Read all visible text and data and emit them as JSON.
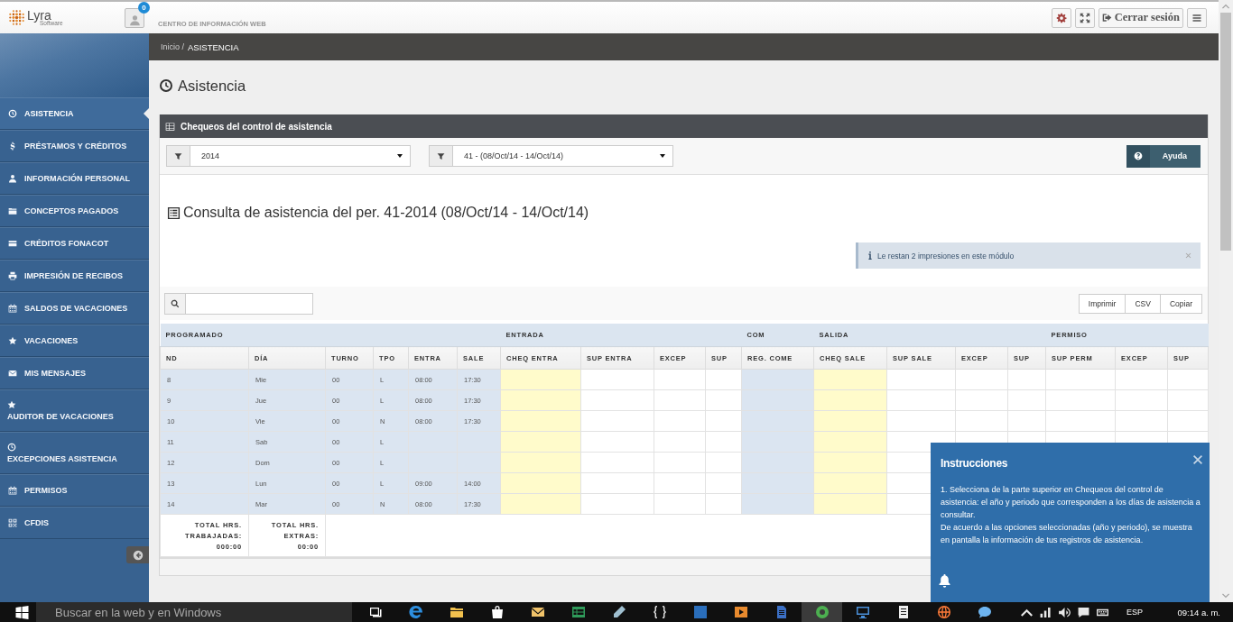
{
  "header": {
    "logo": {
      "name": "Lyra",
      "tagline": "Software"
    },
    "notifications": {
      "badge": "0"
    },
    "subtitle": "CENTRO DE INFORMACIÓN WEB",
    "logout": {
      "label": "Cerrar sesión"
    }
  },
  "sidebar": {
    "items": [
      {
        "label": "ASISTENCIA",
        "kind": "inline",
        "selected": true
      },
      {
        "label": "PRÉSTAMOS Y CRÉDITOS",
        "kind": "inline",
        "selected": false
      },
      {
        "label": "INFORMACIÓN PERSONAL",
        "kind": "inline",
        "selected": false
      },
      {
        "label": "CONCEPTOS PAGADOS",
        "kind": "inline",
        "selected": false
      },
      {
        "label": "CRÉDITOS FONACOT",
        "kind": "inline",
        "selected": false
      },
      {
        "label": "IMPRESIÓN DE RECIBOS",
        "kind": "inline",
        "selected": false
      },
      {
        "label": "SALDOS DE VACACIONES",
        "kind": "inline",
        "selected": false
      },
      {
        "label": "VACACIONES",
        "kind": "inline",
        "selected": false
      },
      {
        "label": "MIS MENSAJES",
        "kind": "inline",
        "selected": false
      },
      {
        "label": "AUDITOR DE VACACIONES",
        "kind": "stacked",
        "selected": false
      },
      {
        "label": "EXCEPCIONES ASISTENCIA",
        "kind": "stacked",
        "selected": false
      },
      {
        "label": "PERMISOS",
        "kind": "inline",
        "selected": false
      },
      {
        "label": "CFDIS",
        "kind": "inline",
        "selected": false
      }
    ]
  },
  "breadcrumb": [
    "Inicio /",
    "ASISTENCIA"
  ],
  "page_title": "Asistencia",
  "panel": {
    "title": "Chequeos del control de asistencia",
    "filters": [
      {
        "value": "2014"
      },
      {
        "value": "41 - (08/Oct/14 - 14/Oct/14)"
      }
    ],
    "help_button": "Ayuda"
  },
  "report": {
    "title": "Consulta de asistencia del per. 41-2014 (08/Oct/14 - 14/Oct/14)",
    "alert": "Le restan 2 impresiones en este módulo",
    "export_buttons": [
      "Imprimir",
      "CSV",
      "Copiar"
    ]
  },
  "table": {
    "groups": [
      {
        "label": "PROGRAMADO",
        "columns": [
          {
            "label": "ND",
            "kind": "schedule"
          },
          {
            "label": "DÍA",
            "kind": "schedule"
          },
          {
            "label": "TURNO",
            "kind": "schedule"
          },
          {
            "label": "TPO",
            "kind": "schedule"
          },
          {
            "label": "ENTRA",
            "kind": "schedule"
          },
          {
            "label": "SALE",
            "kind": "schedule"
          }
        ]
      },
      {
        "label": "ENTRADA",
        "columns": [
          {
            "label": "CHEQ ENTRA",
            "kind": "check"
          },
          {
            "label": "SUP ENTRA",
            "kind": "plain"
          },
          {
            "label": "EXCEP",
            "kind": "plain"
          },
          {
            "label": "SUP",
            "kind": "plain"
          }
        ]
      },
      {
        "label": "COM",
        "columns": [
          {
            "label": "REG. COME",
            "kind": "schedule"
          }
        ]
      },
      {
        "label": "SALIDA",
        "columns": [
          {
            "label": "CHEQ SALE",
            "kind": "check"
          },
          {
            "label": "SUP SALE",
            "kind": "plain"
          },
          {
            "label": "EXCEP",
            "kind": "plain"
          },
          {
            "label": "SUP",
            "kind": "plain"
          }
        ]
      },
      {
        "label": "PERMISO",
        "columns": [
          {
            "label": "SUP PERM",
            "kind": "plain"
          },
          {
            "label": "EXCEP",
            "kind": "plain"
          },
          {
            "label": "SUP",
            "kind": "plain"
          }
        ]
      }
    ],
    "rows": [
      [
        "8",
        "Mie",
        "00",
        "L",
        "08:00",
        "17:30"
      ],
      [
        "9",
        "Jue",
        "00",
        "L",
        "08:00",
        "17:30"
      ],
      [
        "10",
        "Vie",
        "00",
        "N",
        "08:00",
        "17:30"
      ],
      [
        "11",
        "Sab",
        "00",
        "L"
      ],
      [
        "12",
        "Dom",
        "00",
        "L"
      ],
      [
        "13",
        "Lun",
        "00",
        "L",
        "09:00",
        "14:00"
      ],
      [
        "14",
        "Mar",
        "00",
        "N",
        "08:00",
        "17:30"
      ]
    ],
    "totals": [
      {
        "label": "TOTAL HRS. TRABAJADAS:",
        "value": "000:00"
      },
      {
        "label": "TOTAL HRS. EXTRAS:",
        "value": "00:00"
      }
    ]
  },
  "popup": {
    "title": "Instrucciones",
    "paragraphs": [
      "1. Selecciona de la parte superior en Chequeos del control de asistencia: el año y periodo que corresponden a los días de asistencia a consultar.",
      "De acuerdo a las opciones seleccionadas (año y periodo), se muestra en pantalla la información de tus registros de asistencia."
    ]
  },
  "taskbar": {
    "search": {
      "placeholder": "Buscar en la web y en Windows"
    },
    "apps": [
      {
        "selected": false
      },
      {
        "selected": false
      },
      {
        "selected": false
      },
      {
        "selected": false
      },
      {
        "selected": false
      },
      {
        "selected": false
      },
      {
        "selected": false
      },
      {
        "selected": false
      },
      {
        "selected": false
      },
      {
        "selected": false
      },
      {
        "selected": false
      },
      {
        "selected": true
      },
      {
        "selected": false
      },
      {
        "selected": false
      },
      {
        "selected": false
      },
      {
        "selected": false
      }
    ],
    "language": "ESP",
    "clock": "09:14 a. m."
  }
}
